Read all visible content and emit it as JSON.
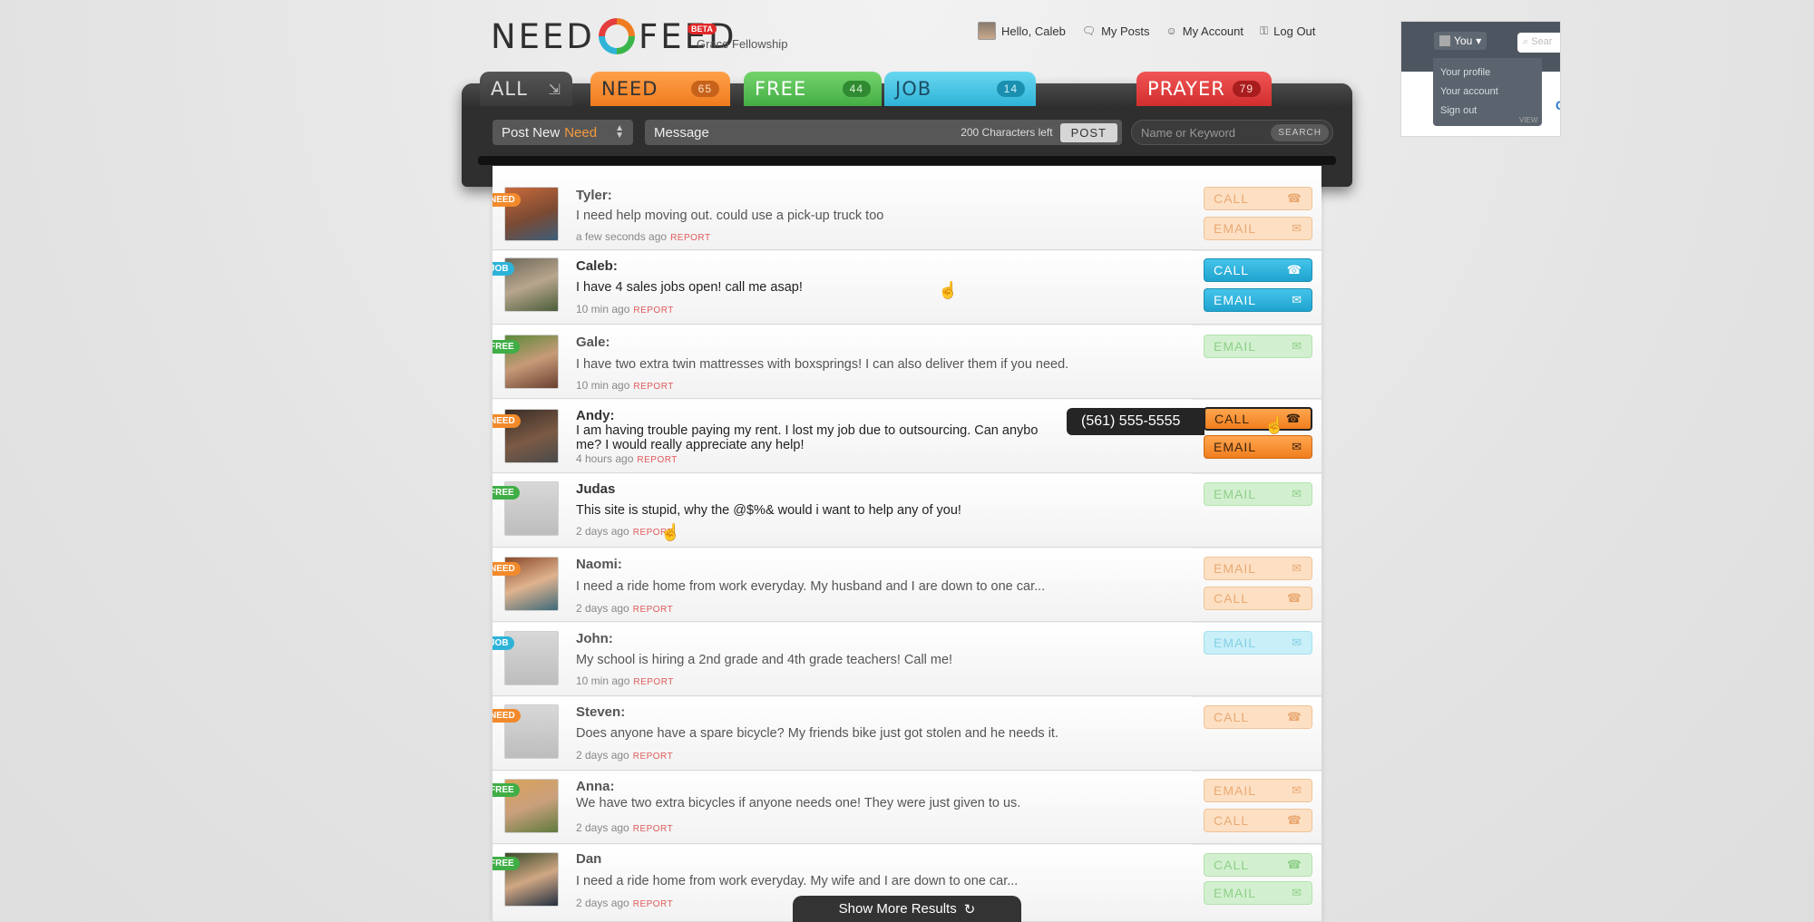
{
  "logo": {
    "left_word": "NEED",
    "right_word": "FEED",
    "beta": "BETA",
    "church": "Grace Fellowship"
  },
  "topnav": {
    "greeting": "Hello, Caleb",
    "my_posts": "My Posts",
    "my_account": "My Account",
    "log_out": "Log Out"
  },
  "mini_profile": {
    "you": "You",
    "search_placeholder": "Sear",
    "menu": [
      "Your profile",
      "Your account",
      "Sign out"
    ],
    "partial_value": "C",
    "partial_label": "VIEW"
  },
  "tabs": {
    "all": {
      "label": "ALL"
    },
    "need": {
      "label": "NEED",
      "count": "65"
    },
    "free": {
      "label": "FREE",
      "count": "44"
    },
    "job": {
      "label": "JOB",
      "count": "14"
    },
    "prayer": {
      "label": "PRAYER",
      "count": "79"
    }
  },
  "composer": {
    "post_prefix": "Post New",
    "post_type": "Need",
    "message_placeholder": "Message",
    "chars_left": "200 Characters left",
    "post_button": "POST",
    "search_placeholder": "Name or Keyword",
    "search_button": "SEARCH"
  },
  "colors": {
    "need": "#f28a2b",
    "free": "#3fae45",
    "job": "#2eb3d8",
    "prayer": "#d22f2f"
  },
  "feed": [
    {
      "category": "NEED",
      "name": "Tyler:",
      "message": "I need help moving out. could use a pick-up truck too",
      "time": "a few seconds ago",
      "report": "REPORT",
      "actions": [
        "CALL",
        "EMAIL"
      ]
    },
    {
      "category": "JOB",
      "name": "Caleb:",
      "message": "I have 4 sales jobs open!  call me asap!",
      "time": "10 min ago",
      "report": "REPORT",
      "actions": [
        "CALL",
        "EMAIL"
      ]
    },
    {
      "category": "FREE",
      "name": "Gale:",
      "message": "I have two extra twin mattresses with boxsprings!  I can also deliver them if you need.",
      "time": "10 min ago",
      "report": "REPORT",
      "actions": [
        "EMAIL"
      ]
    },
    {
      "category": "NEED",
      "name": "Andy:",
      "message": "I am having trouble paying my rent. I lost my job due to outsourcing. Can anybo",
      "message_line2": "me? I would really appreciate any help!",
      "time": "4 hours ago",
      "report": "REPORT",
      "actions": [
        "CALL",
        "EMAIL"
      ],
      "phone": "(561) 555-5555"
    },
    {
      "category": "FREE",
      "name": "Judas",
      "message": "This site is stupid, why the @$%& would i want to help any of you!",
      "time": "2 days ago",
      "report": "REPORT",
      "actions": [
        "EMAIL"
      ]
    },
    {
      "category": "NEED",
      "name": "Naomi:",
      "message": "I need a ride home from work everyday.  My husband and I are down to one car...",
      "time": "2 days ago",
      "report": "REPORT",
      "actions": [
        "EMAIL",
        "CALL"
      ]
    },
    {
      "category": "JOB",
      "name": "John:",
      "message": "My school is hiring a 2nd grade and 4th grade teachers!  Call me!",
      "time": "10 min ago",
      "report": "REPORT",
      "actions": [
        "EMAIL"
      ]
    },
    {
      "category": "NEED",
      "name": "Steven:",
      "message": "Does anyone have a spare bicycle?  My friends bike just got stolen and he needs it.",
      "time": "2 days ago",
      "report": "REPORT",
      "actions": [
        "CALL"
      ]
    },
    {
      "category": "FREE",
      "name": "Anna:",
      "message": "We have two extra bicycles if anyone needs one!  They were just given to us.",
      "time": "2 days ago",
      "report": "REPORT",
      "actions": [
        "EMAIL",
        "CALL"
      ]
    },
    {
      "category": "FREE",
      "name": "Dan",
      "message": "I need a ride home from work everyday.  My wife and I are down to one car...",
      "time": "2 days ago",
      "report": "REPORT",
      "actions": [
        "CALL",
        "EMAIL"
      ]
    }
  ],
  "show_more": "Show More Results"
}
